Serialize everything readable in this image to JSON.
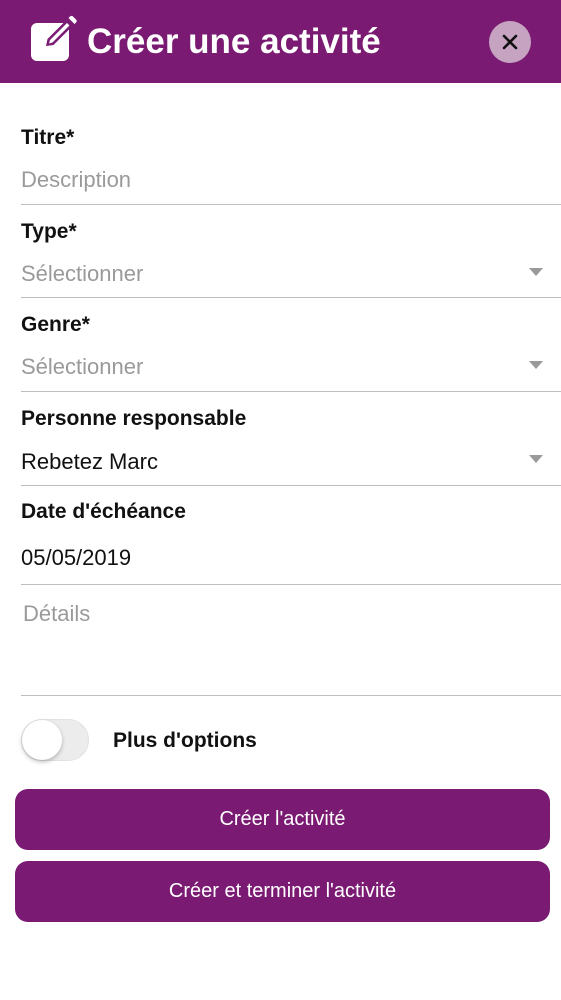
{
  "header": {
    "title": "Créer une activité",
    "icon": "edit-icon",
    "close_icon": "close-icon",
    "background_color": "#7a1a72"
  },
  "form": {
    "title_field": {
      "label": "Titre*",
      "placeholder": "Description"
    },
    "type_field": {
      "label": "Type*",
      "placeholder": "Sélectionner"
    },
    "genre_field": {
      "label": "Genre*",
      "placeholder": "Sélectionner"
    },
    "responsible_field": {
      "label": "Personne responsable",
      "value": "Rebetez Marc"
    },
    "due_date_field": {
      "label": "Date d'échéance",
      "value": "05/05/2019"
    },
    "details_field": {
      "placeholder": "Détails"
    }
  },
  "options": {
    "toggle_label": "Plus d'options",
    "toggle_on": false
  },
  "actions": {
    "create_label": "Créer l'activité",
    "create_and_finish_label": "Créer et terminer l'activité",
    "button_color": "#7a1a72"
  }
}
